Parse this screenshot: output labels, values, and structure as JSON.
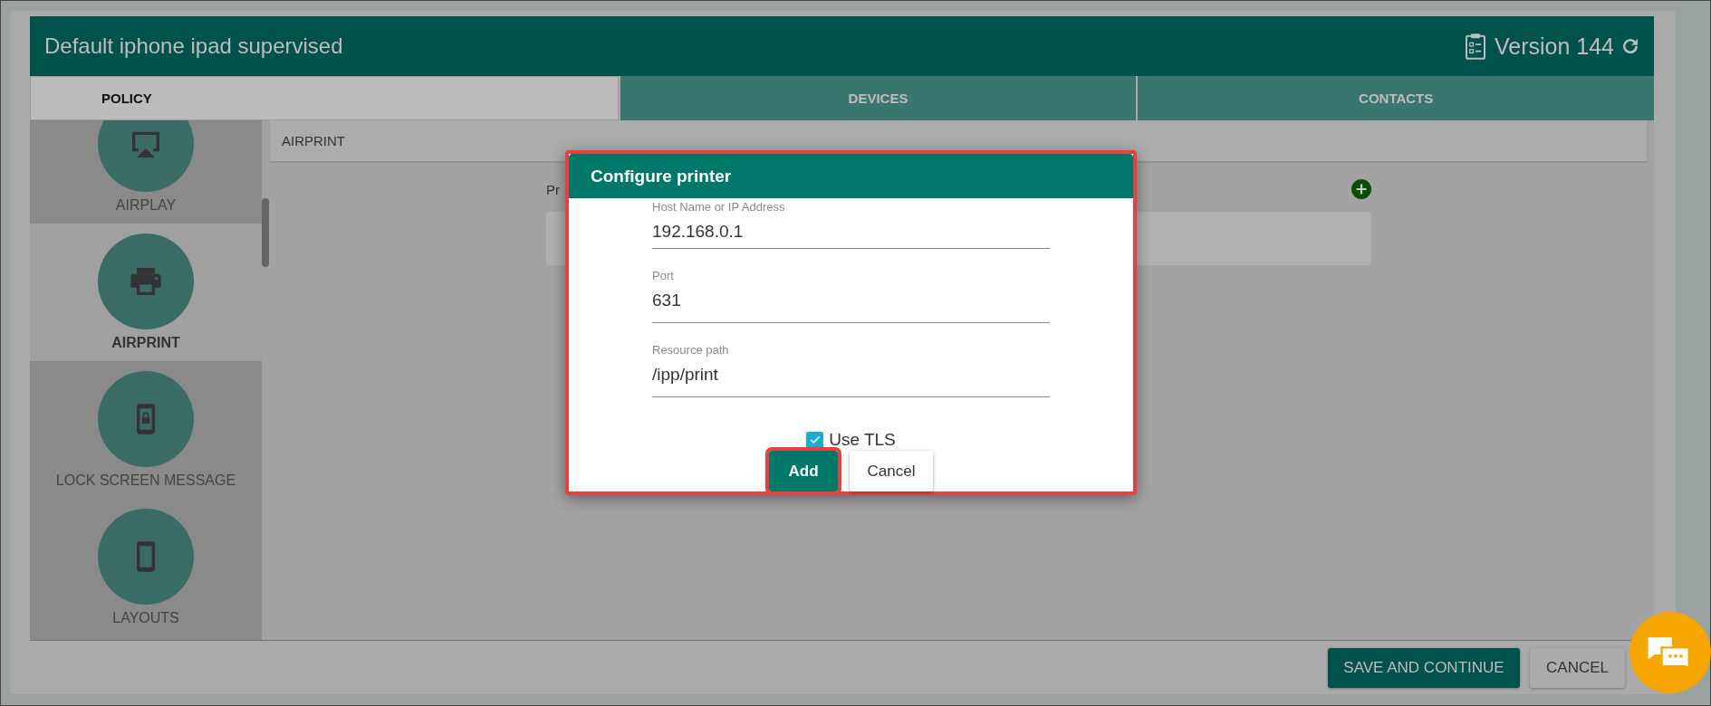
{
  "header": {
    "title": "Default iphone ipad supervised",
    "version": "Version 144"
  },
  "tabs": [
    {
      "label": "POLICY",
      "selected": true
    },
    {
      "label": "DEVICES",
      "selected": false
    },
    {
      "label": "CONTACTS",
      "selected": false
    }
  ],
  "sidebar": {
    "items": [
      {
        "label": "AIRPLAY",
        "kind": "airplay",
        "selected": false
      },
      {
        "label": "AIRPRINT",
        "kind": "printer",
        "selected": true
      },
      {
        "label": "LOCK SCREEN MESSAGE",
        "kind": "lock",
        "selected": false
      },
      {
        "label": "LAYOUTS",
        "kind": "tablet",
        "selected": false
      }
    ]
  },
  "section_title": "AIRPRINT",
  "printers": {
    "label": "Pr"
  },
  "dialog": {
    "title": "Configure printer",
    "highlighted": true,
    "fields": [
      {
        "label": "Host Name or IP Address",
        "value": "192.168.0.1"
      },
      {
        "label": "Port",
        "value": "631"
      },
      {
        "label": "Resource path",
        "value": "/ipp/print"
      }
    ],
    "use_tls": {
      "label": "Use TLS",
      "checked": true
    },
    "buttons": [
      {
        "label": "Add",
        "kind": "primary",
        "highlighted": true
      },
      {
        "label": "Cancel",
        "kind": "secondary",
        "highlighted": false
      }
    ]
  },
  "footer": {
    "buttons": [
      {
        "label": "SAVE AND CONTINUE",
        "kind": "primary"
      },
      {
        "label": "CANCEL",
        "kind": "secondary"
      }
    ]
  }
}
